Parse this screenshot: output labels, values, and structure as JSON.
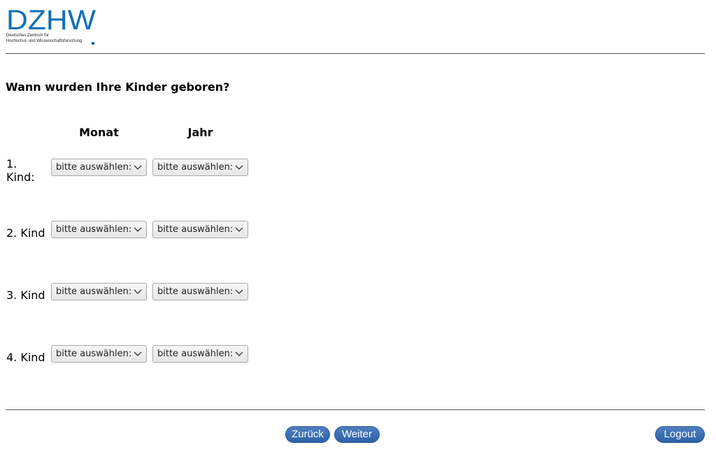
{
  "logo": {
    "wordmark": "DZHW",
    "subtitle_line1": "Deutsches Zentrum für",
    "subtitle_line2": "Hochschul- und Wissenschaftsforschung",
    "brand_color": "#0f6fb3"
  },
  "question": "Wann wurden Ihre Kinder geboren?",
  "columns": {
    "month": "Monat",
    "year": "Jahr"
  },
  "rows": [
    {
      "label_line1": "1.",
      "label_line2": "Kind:",
      "month_value": "bitte auswählen:",
      "year_value": "bitte auswählen:"
    },
    {
      "label": "2. Kind",
      "month_value": "bitte auswählen:",
      "year_value": "bitte auswählen:"
    },
    {
      "label": "3. Kind",
      "month_value": "bitte auswählen:",
      "year_value": "bitte auswählen:"
    },
    {
      "label": "4. Kind",
      "month_value": "bitte auswählen:",
      "year_value": "bitte auswählen:"
    }
  ],
  "nav": {
    "back": "Zurück",
    "next": "Weiter",
    "logout": "Logout"
  },
  "colors": {
    "button": "#2d62a8",
    "rule": "#555555"
  }
}
